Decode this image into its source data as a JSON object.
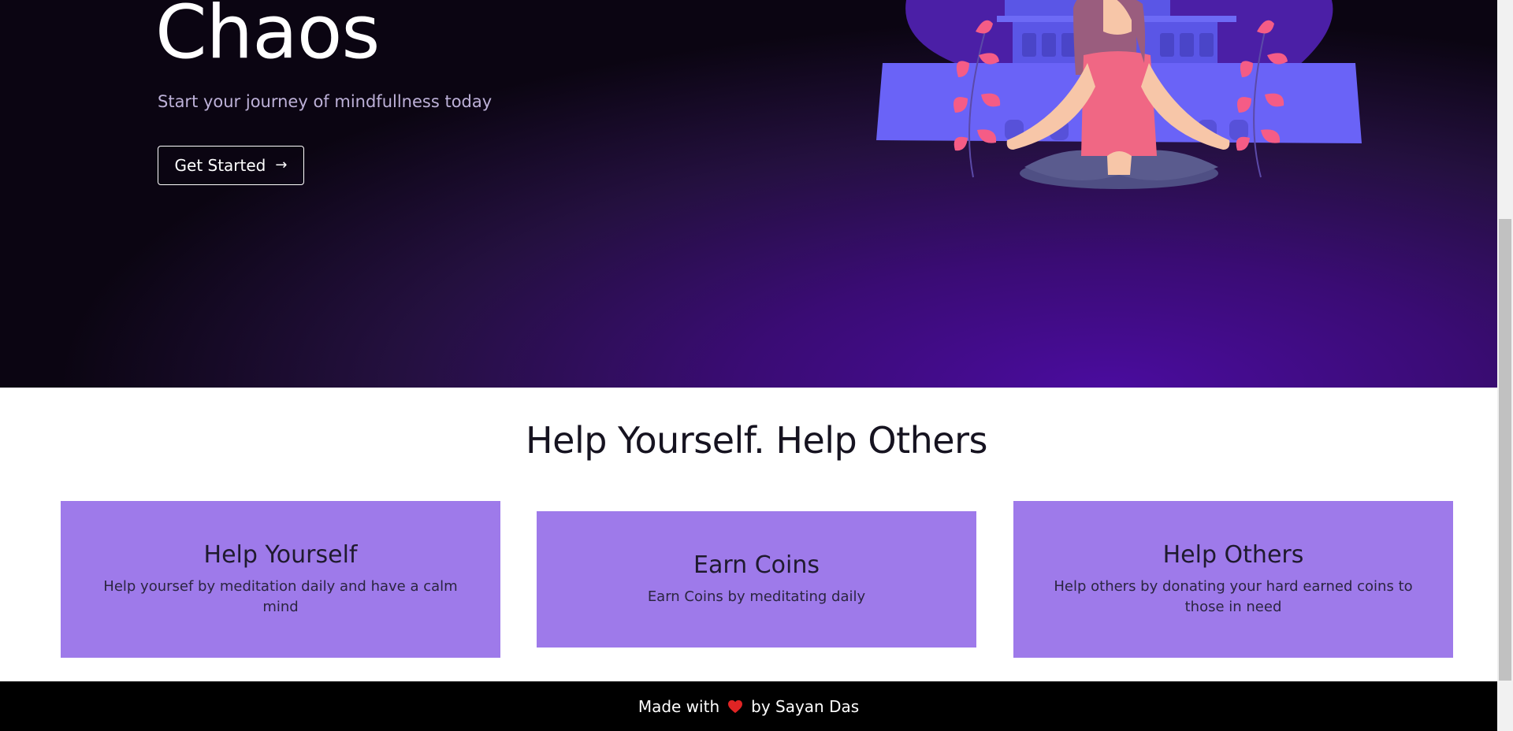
{
  "hero": {
    "title": "Chaos",
    "subtitle": "Start your journey of mindfullness today",
    "cta_label": "Get Started",
    "cta_icon": "arrow-right-icon",
    "illustration": "meditating-woman-illustration"
  },
  "features": {
    "heading": "Help Yourself. Help Others",
    "cards": [
      {
        "title": "Help Yourself",
        "text": "Help yoursef by meditation daily and have a calm mind"
      },
      {
        "title": "Earn Coins",
        "text": "Earn Coins by meditating daily"
      },
      {
        "title": "Help Others",
        "text": "Help others by donating your hard earned coins to those in need"
      }
    ]
  },
  "footer": {
    "prefix": "Made with",
    "icon": "heart-icon",
    "suffix": "by Sayan Das"
  },
  "colors": {
    "card_bg": "#9e7aea",
    "hero_accent": "#4a0c9e",
    "footer_bg": "#000000",
    "heart": "#e02424"
  }
}
